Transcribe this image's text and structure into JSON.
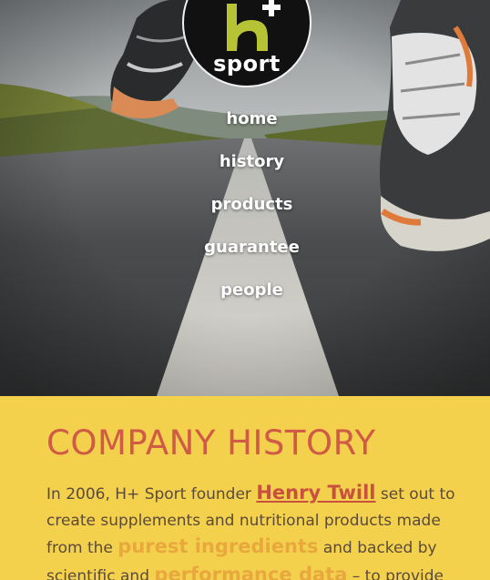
{
  "brand": {
    "logo_letter": "h",
    "logo_plus": "+",
    "logo_word": "sport"
  },
  "nav": {
    "items": [
      "home",
      "history",
      "products",
      "guarantee",
      "people"
    ]
  },
  "content": {
    "heading": "COMPANY HISTORY",
    "intro": {
      "part1": "In 2006, H+ Sport founder",
      "founder_name": "Henry Twill",
      "part2": "set out to create supplements and nutritional products made from the",
      "highlight1": "purest ingredients",
      "part3": "and backed by scientific and",
      "highlight2": "performance data",
      "part4": "– to provide"
    }
  },
  "colors": {
    "yellow_bg": "#f4d14d",
    "heading_red": "#cf5a45",
    "link_red": "#c8503f",
    "highlight_orange": "#e8a83e",
    "body_text": "#5a4a3c",
    "logo_green": "#b5c334"
  }
}
